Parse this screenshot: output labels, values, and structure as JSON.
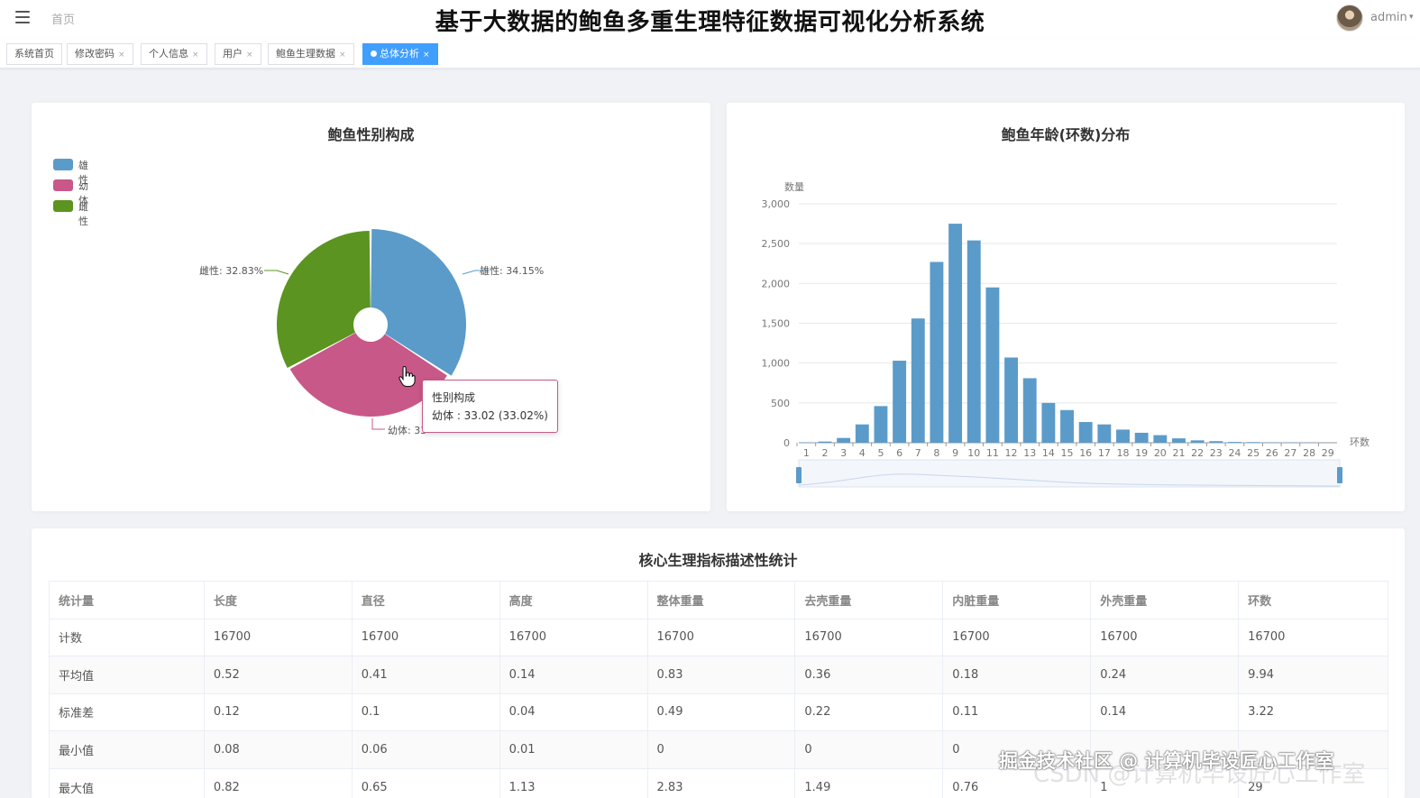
{
  "header": {
    "home_crumb": "首页",
    "system_title": "基于大数据的鲍鱼多重生理特征数据可视化分析系统",
    "user_name": "admin",
    "caret": "▾"
  },
  "tags": [
    {
      "label": "系统首页",
      "close": ""
    },
    {
      "label": "修改密码",
      "close": "×"
    },
    {
      "label": "个人信息",
      "close": "×"
    },
    {
      "label": "用户",
      "close": "×"
    },
    {
      "label": "鲍鱼生理数据",
      "close": "×"
    },
    {
      "label": "总体分析",
      "close": "×"
    }
  ],
  "pie_card": {
    "title": "鲍鱼性别构成",
    "legend": [
      {
        "label": "雄性",
        "color": "#5b9bc9"
      },
      {
        "label": "幼体",
        "color": "#c85887"
      },
      {
        "label": "雌性",
        "color": "#5b9420"
      }
    ],
    "labels": {
      "male": "雄性: 34.15%",
      "female": "雌性: 32.83%",
      "juvenile": "幼体: 33"
    },
    "tooltip": {
      "title": "性别构成",
      "body": "幼体 : 33.02 (33.02%)"
    }
  },
  "bar_card": {
    "title": "鲍鱼年龄(环数)分布",
    "y_axis_name": "数量",
    "x_axis_name": "环数",
    "y_ticks": [
      "0",
      "500",
      "1,000",
      "1,500",
      "2,000",
      "2,500",
      "3,000"
    ]
  },
  "chart_data": [
    {
      "type": "pie",
      "title": "鲍鱼性别构成",
      "slices": [
        {
          "name": "雄性",
          "value": 34.15,
          "color": "#5b9bc9"
        },
        {
          "name": "幼体",
          "value": 33.02,
          "color": "#c85887"
        },
        {
          "name": "雌性",
          "value": 32.83,
          "color": "#5b9420"
        }
      ],
      "legend_position": "top-left"
    },
    {
      "type": "bar",
      "title": "鲍鱼年龄(环数)分布",
      "xlabel": "环数",
      "ylabel": "数量",
      "ylim": [
        0,
        3000
      ],
      "grid": true,
      "color": "#5b9bc9",
      "categories": [
        "1",
        "2",
        "3",
        "4",
        "5",
        "6",
        "7",
        "8",
        "9",
        "10",
        "11",
        "12",
        "13",
        "14",
        "15",
        "16",
        "17",
        "18",
        "19",
        "20",
        "21",
        "22",
        "23",
        "24",
        "25",
        "26",
        "27",
        "28",
        "29"
      ],
      "values": [
        5,
        15,
        60,
        230,
        460,
        1030,
        1560,
        2270,
        2750,
        2540,
        1950,
        1070,
        810,
        500,
        410,
        260,
        230,
        165,
        125,
        95,
        55,
        30,
        20,
        10,
        8,
        5,
        4,
        3,
        2
      ]
    }
  ],
  "table": {
    "title": "核心生理指标描述性统计",
    "headers": [
      "统计量",
      "长度",
      "直径",
      "高度",
      "整体重量",
      "去壳重量",
      "内脏重量",
      "外壳重量",
      "环数"
    ],
    "rows": [
      [
        "计数",
        "16700",
        "16700",
        "16700",
        "16700",
        "16700",
        "16700",
        "16700",
        "16700"
      ],
      [
        "平均值",
        "0.52",
        "0.41",
        "0.14",
        "0.83",
        "0.36",
        "0.18",
        "0.24",
        "9.94"
      ],
      [
        "标准差",
        "0.12",
        "0.1",
        "0.04",
        "0.49",
        "0.22",
        "0.11",
        "0.14",
        "3.22"
      ],
      [
        "最小值",
        "0.08",
        "0.06",
        "0.01",
        "0",
        "0",
        "0",
        "",
        ""
      ],
      [
        "最大值",
        "0.82",
        "0.65",
        "1.13",
        "2.83",
        "1.49",
        "0.76",
        "1",
        "29"
      ]
    ]
  },
  "watermark": {
    "line1": "掘金技术社区 @ 计算机毕设匠心工作室",
    "line2": "CSDN @计算机毕设匠心工作室"
  }
}
